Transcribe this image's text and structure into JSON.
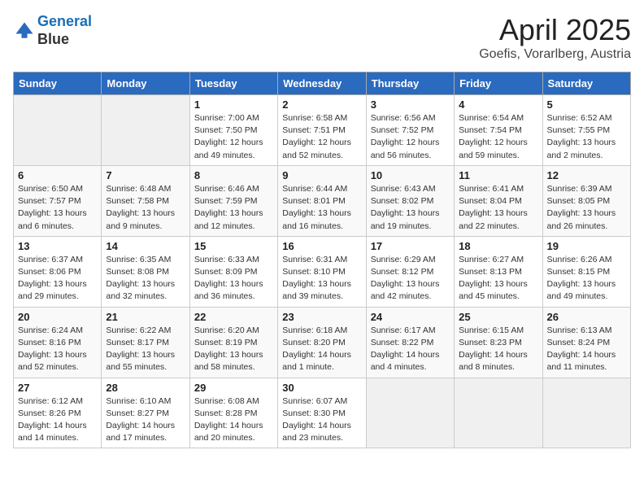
{
  "header": {
    "logo_line1": "General",
    "logo_line2": "Blue",
    "title": "April 2025",
    "location": "Goefis, Vorarlberg, Austria"
  },
  "days_of_week": [
    "Sunday",
    "Monday",
    "Tuesday",
    "Wednesday",
    "Thursday",
    "Friday",
    "Saturday"
  ],
  "weeks": [
    [
      {
        "num": "",
        "info": ""
      },
      {
        "num": "",
        "info": ""
      },
      {
        "num": "1",
        "info": "Sunrise: 7:00 AM\nSunset: 7:50 PM\nDaylight: 12 hours\nand 49 minutes."
      },
      {
        "num": "2",
        "info": "Sunrise: 6:58 AM\nSunset: 7:51 PM\nDaylight: 12 hours\nand 52 minutes."
      },
      {
        "num": "3",
        "info": "Sunrise: 6:56 AM\nSunset: 7:52 PM\nDaylight: 12 hours\nand 56 minutes."
      },
      {
        "num": "4",
        "info": "Sunrise: 6:54 AM\nSunset: 7:54 PM\nDaylight: 12 hours\nand 59 minutes."
      },
      {
        "num": "5",
        "info": "Sunrise: 6:52 AM\nSunset: 7:55 PM\nDaylight: 13 hours\nand 2 minutes."
      }
    ],
    [
      {
        "num": "6",
        "info": "Sunrise: 6:50 AM\nSunset: 7:57 PM\nDaylight: 13 hours\nand 6 minutes."
      },
      {
        "num": "7",
        "info": "Sunrise: 6:48 AM\nSunset: 7:58 PM\nDaylight: 13 hours\nand 9 minutes."
      },
      {
        "num": "8",
        "info": "Sunrise: 6:46 AM\nSunset: 7:59 PM\nDaylight: 13 hours\nand 12 minutes."
      },
      {
        "num": "9",
        "info": "Sunrise: 6:44 AM\nSunset: 8:01 PM\nDaylight: 13 hours\nand 16 minutes."
      },
      {
        "num": "10",
        "info": "Sunrise: 6:43 AM\nSunset: 8:02 PM\nDaylight: 13 hours\nand 19 minutes."
      },
      {
        "num": "11",
        "info": "Sunrise: 6:41 AM\nSunset: 8:04 PM\nDaylight: 13 hours\nand 22 minutes."
      },
      {
        "num": "12",
        "info": "Sunrise: 6:39 AM\nSunset: 8:05 PM\nDaylight: 13 hours\nand 26 minutes."
      }
    ],
    [
      {
        "num": "13",
        "info": "Sunrise: 6:37 AM\nSunset: 8:06 PM\nDaylight: 13 hours\nand 29 minutes."
      },
      {
        "num": "14",
        "info": "Sunrise: 6:35 AM\nSunset: 8:08 PM\nDaylight: 13 hours\nand 32 minutes."
      },
      {
        "num": "15",
        "info": "Sunrise: 6:33 AM\nSunset: 8:09 PM\nDaylight: 13 hours\nand 36 minutes."
      },
      {
        "num": "16",
        "info": "Sunrise: 6:31 AM\nSunset: 8:10 PM\nDaylight: 13 hours\nand 39 minutes."
      },
      {
        "num": "17",
        "info": "Sunrise: 6:29 AM\nSunset: 8:12 PM\nDaylight: 13 hours\nand 42 minutes."
      },
      {
        "num": "18",
        "info": "Sunrise: 6:27 AM\nSunset: 8:13 PM\nDaylight: 13 hours\nand 45 minutes."
      },
      {
        "num": "19",
        "info": "Sunrise: 6:26 AM\nSunset: 8:15 PM\nDaylight: 13 hours\nand 49 minutes."
      }
    ],
    [
      {
        "num": "20",
        "info": "Sunrise: 6:24 AM\nSunset: 8:16 PM\nDaylight: 13 hours\nand 52 minutes."
      },
      {
        "num": "21",
        "info": "Sunrise: 6:22 AM\nSunset: 8:17 PM\nDaylight: 13 hours\nand 55 minutes."
      },
      {
        "num": "22",
        "info": "Sunrise: 6:20 AM\nSunset: 8:19 PM\nDaylight: 13 hours\nand 58 minutes."
      },
      {
        "num": "23",
        "info": "Sunrise: 6:18 AM\nSunset: 8:20 PM\nDaylight: 14 hours\nand 1 minute."
      },
      {
        "num": "24",
        "info": "Sunrise: 6:17 AM\nSunset: 8:22 PM\nDaylight: 14 hours\nand 4 minutes."
      },
      {
        "num": "25",
        "info": "Sunrise: 6:15 AM\nSunset: 8:23 PM\nDaylight: 14 hours\nand 8 minutes."
      },
      {
        "num": "26",
        "info": "Sunrise: 6:13 AM\nSunset: 8:24 PM\nDaylight: 14 hours\nand 11 minutes."
      }
    ],
    [
      {
        "num": "27",
        "info": "Sunrise: 6:12 AM\nSunset: 8:26 PM\nDaylight: 14 hours\nand 14 minutes."
      },
      {
        "num": "28",
        "info": "Sunrise: 6:10 AM\nSunset: 8:27 PM\nDaylight: 14 hours\nand 17 minutes."
      },
      {
        "num": "29",
        "info": "Sunrise: 6:08 AM\nSunset: 8:28 PM\nDaylight: 14 hours\nand 20 minutes."
      },
      {
        "num": "30",
        "info": "Sunrise: 6:07 AM\nSunset: 8:30 PM\nDaylight: 14 hours\nand 23 minutes."
      },
      {
        "num": "",
        "info": ""
      },
      {
        "num": "",
        "info": ""
      },
      {
        "num": "",
        "info": ""
      }
    ]
  ]
}
